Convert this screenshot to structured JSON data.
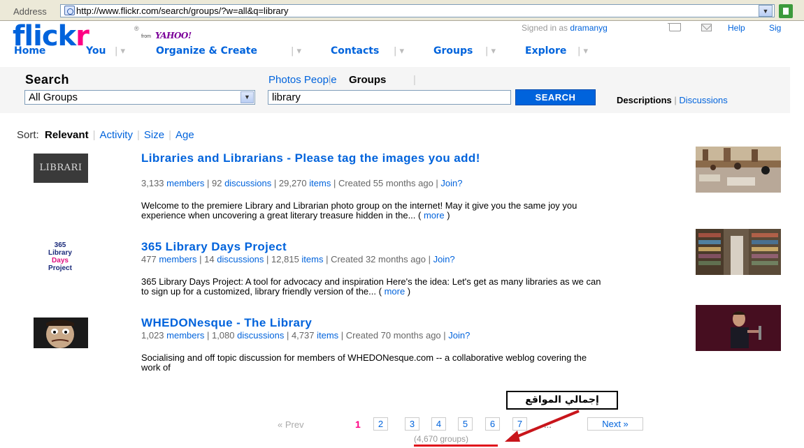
{
  "browser": {
    "address_label": "Address",
    "url": "http://www.flickr.com/search/groups/?w=all&q=library"
  },
  "header": {
    "logo_text_blue": "flick",
    "logo_text_pink": "r",
    "logo_registered": "®",
    "from_label": "from",
    "yahoo_label": "YAHOO!",
    "signed_in_prefix": "Signed in as",
    "username": "dramanyg",
    "help": "Help",
    "signout": "Sig"
  },
  "nav": {
    "items": [
      "Home",
      "You",
      "Organize & Create",
      "Contacts",
      "Groups",
      "Explore"
    ]
  },
  "search": {
    "title": "Search",
    "scope_value": "All Groups",
    "tabs": [
      "Photos",
      "Groups",
      "People"
    ],
    "active_tab": "Groups",
    "query": "library",
    "button": "SEARCH",
    "descriptions": "Descriptions",
    "discussions": "Discussions"
  },
  "sort": {
    "label": "Sort:",
    "options": [
      "Relevant",
      "Activity",
      "Size",
      "Age"
    ],
    "current": "Relevant"
  },
  "results": [
    {
      "title": "Libraries and Librarians - Please tag the images you add!",
      "icon_text": "LIBRARI",
      "members_count": "3,133",
      "members_label": "members",
      "discussions_count": "92",
      "discussions_label": "discussions",
      "items_count": "29,270",
      "items_label": "items",
      "created": "Created 55 months ago",
      "join": "Join?",
      "description": "Welcome to the premiere Library and Librarian photo group on the internet! May it give you the same joy you experience when uncovering a great literary treasure hidden in the...",
      "more": "more"
    },
    {
      "title": "365 Library Days Project",
      "icon_lines": [
        "365",
        "Library",
        "Days",
        "Project"
      ],
      "members_count": "477",
      "members_label": "members",
      "discussions_count": "14",
      "discussions_label": "discussions",
      "items_count": "12,815",
      "items_label": "items",
      "created": "Created 32 months ago",
      "join": "Join?",
      "description": "365 Library Days Project: A tool for advocacy and inspiration Here's the idea: Let's get as many libraries as we can to sign up for a customized, library friendly version of the...",
      "more": "more"
    },
    {
      "title": "WHEDONesque - The Library",
      "members_count": "1,023",
      "members_label": "members",
      "discussions_count": "1,080",
      "discussions_label": "discussions",
      "items_count": "4,737",
      "items_label": "items",
      "created": "Created 70 months ago",
      "join": "Join?",
      "description": "Socialising and off topic discussion for members of WHEDONesque.com -- a collaborative weblog covering the work of"
    }
  ],
  "pagination": {
    "prev": "« Prev",
    "current": "1",
    "pages": [
      "2",
      "3",
      "4",
      "5",
      "6",
      "7"
    ],
    "ellipsis": "...",
    "next": "Next »",
    "total": "(4,670 groups)"
  },
  "annotation": {
    "callout_text": "إجمالي المواقع",
    "colors": {
      "arrow": "#C8151B",
      "underline": "#E0101B"
    }
  },
  "colors": {
    "brand_blue": "#0063DC",
    "brand_pink": "#FF0084",
    "search_button": "#0063DC"
  }
}
